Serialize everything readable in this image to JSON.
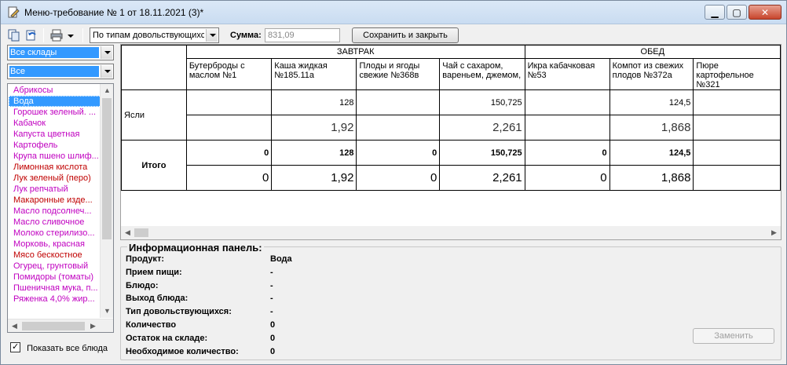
{
  "window": {
    "title": "Меню-требование № 1 от 18.11.2021 (3)*",
    "buttons": {
      "minimize": "▁",
      "maximize": "▢",
      "close": "✕"
    }
  },
  "toolbar": {
    "icons": [
      "copy-icon",
      "undo-icon",
      "print-icon",
      "dropdown-arrow-icon"
    ],
    "consumer_type": "По типам довольствующихся",
    "sum_label": "Сумма:",
    "sum_value": "831,09",
    "save_close_label": "Сохранить и закрыть"
  },
  "left_panel": {
    "warehouse_select": "Все склады",
    "filter_select": "Все",
    "products": [
      {
        "label": "Абрикосы",
        "color": "magenta"
      },
      {
        "label": "Вода",
        "color": "selected"
      },
      {
        "label": "Горошек зеленый. ...",
        "color": "magenta"
      },
      {
        "label": "Кабачок",
        "color": "magenta"
      },
      {
        "label": "Капуста цветная",
        "color": "magenta"
      },
      {
        "label": "Картофель",
        "color": "magenta"
      },
      {
        "label": "Крупа пшено шлиф...",
        "color": "magenta"
      },
      {
        "label": "Лимонная кислота",
        "color": "red"
      },
      {
        "label": "Лук зеленый (перо)",
        "color": "red"
      },
      {
        "label": "Лук репчатый",
        "color": "magenta"
      },
      {
        "label": "Макаронные изде...",
        "color": "red"
      },
      {
        "label": "Масло подсолнеч...",
        "color": "magenta"
      },
      {
        "label": "Масло сливочное",
        "color": "magenta"
      },
      {
        "label": "Молоко стерилизо...",
        "color": "magenta"
      },
      {
        "label": "Морковь, красная",
        "color": "magenta"
      },
      {
        "label": "Мясо бескостное",
        "color": "red"
      },
      {
        "label": "Огурец, грунтовый",
        "color": "magenta"
      },
      {
        "label": "Помидоры (томаты)",
        "color": "magenta"
      },
      {
        "label": "Пшеничная мука, п...",
        "color": "magenta"
      },
      {
        "label": "Ряженка 4,0% жир...",
        "color": "magenta"
      }
    ],
    "show_all_label": "Показать все блюда",
    "show_all_checked": true
  },
  "grid": {
    "groups": [
      {
        "label": "ЗАВТРАК",
        "span": 4
      },
      {
        "label": "ОБЕД",
        "span": 3
      }
    ],
    "columns": [
      "Бутерброды с маслом №1",
      "Каша жидкая №185.11а",
      "Плоды и ягоды свежие №368в",
      "Чай с сахаром, вареньем, джемом,",
      "Икра кабачковая №53",
      "Компот из свежих плодов №372а",
      "Пюре картофельное №321"
    ],
    "rows": [
      {
        "label": "Ясли",
        "top": [
          "",
          "128",
          "",
          "150,725",
          "",
          "124,5",
          ""
        ],
        "bottom": [
          "",
          "1,92",
          "",
          "2,261",
          "",
          "1,868",
          ""
        ]
      }
    ],
    "total": {
      "label": "Итого",
      "top": [
        "0",
        "128",
        "0",
        "150,725",
        "0",
        "124,5",
        ""
      ],
      "bottom": [
        "0",
        "1,92",
        "0",
        "2,261",
        "0",
        "1,868",
        ""
      ]
    }
  },
  "info_panel": {
    "title": "Информационная панель:",
    "rows": [
      {
        "label": "Продукт:",
        "value": "Вода"
      },
      {
        "label": "Прием пищи:",
        "value": "-"
      },
      {
        "label": "Блюдо:",
        "value": "-"
      },
      {
        "label": "Выход блюда:",
        "value": "-"
      },
      {
        "label": "Тип довольствующихся:",
        "value": "-"
      },
      {
        "label": "Количество",
        "value": "0"
      },
      {
        "label": "Остаток на складе:",
        "value": "0"
      },
      {
        "label": "Необходимое количество:",
        "value": "0"
      }
    ],
    "replace_label": "Заменить"
  }
}
